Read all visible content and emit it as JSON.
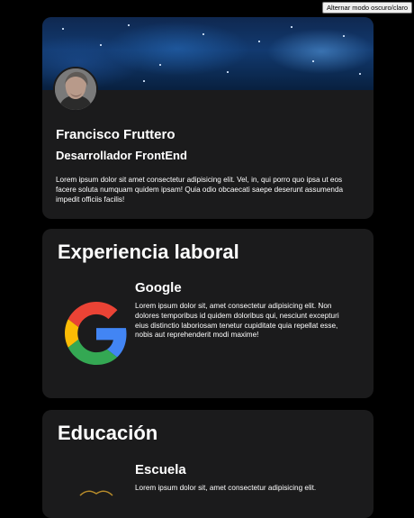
{
  "toggle": {
    "label": "Alternar modo oscuro/claro"
  },
  "profile": {
    "name": "Francisco Fruttero",
    "role": "Desarrollador FrontEnd",
    "bio": "Lorem ipsum dolor sit amet consectetur adipisicing elit. Vel, in, qui porro quo ipsa ut eos facere soluta numquam quidem ipsam! Quia odio obcaecati saepe deserunt assumenda impedit officiis facilis!"
  },
  "experience": {
    "title": "Experiencia laboral",
    "items": [
      {
        "company": "Google",
        "logo": "google-logo",
        "description": "Lorem ipsum dolor sit, amet consectetur adipisicing elit. Non dolores temporibus id quidem doloribus qui, nesciunt excepturi eius distinctio laboriosam tenetur cupiditate quia repellat esse, nobis aut reprehenderit modi maxime!"
      }
    ]
  },
  "education": {
    "title": "Educación",
    "items": [
      {
        "school": "Escuela",
        "logo": "school-logo",
        "description": "Lorem ipsum dolor sit, amet consectetur adipisicing elit."
      }
    ]
  }
}
